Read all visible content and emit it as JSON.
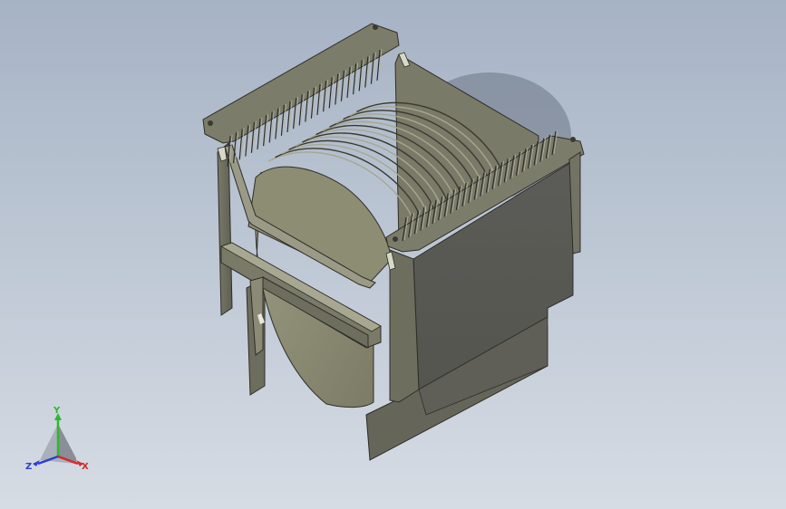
{
  "viewport": {
    "background_top": "#a6b3c5",
    "background_bottom": "#d6dce4"
  },
  "model": {
    "name": "wafer-cassette",
    "body_color": "#6b6b5c",
    "dark_face_color": "#5a5a55",
    "wafer_color": "#8f8f78",
    "edge_color": "#2e2e28",
    "highlight_color": "#b5b5a5"
  },
  "triad": {
    "x_label": "X",
    "y_label": "Y",
    "z_label": "Z",
    "x_color": "#d42a2a",
    "y_color": "#2eb82e",
    "z_color": "#2a3fd4"
  }
}
